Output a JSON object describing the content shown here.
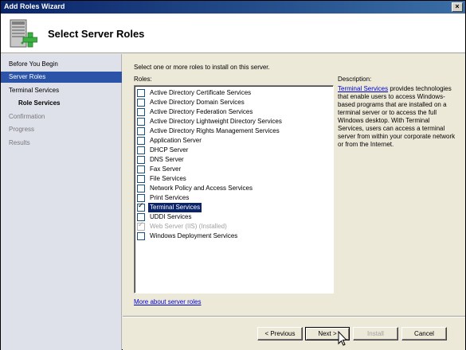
{
  "window": {
    "title": "Add Roles Wizard",
    "close_label": "×"
  },
  "header": {
    "title": "Select Server Roles",
    "icon": "server-roles-icon"
  },
  "nav": {
    "items": [
      {
        "label": "Before You Begin",
        "state": "normal"
      },
      {
        "label": "Server Roles",
        "state": "active"
      },
      {
        "label": "Terminal Services",
        "state": "normal"
      },
      {
        "label": "Role Services",
        "state": "sub"
      },
      {
        "label": "Confirmation",
        "state": "disabled"
      },
      {
        "label": "Progress",
        "state": "disabled"
      },
      {
        "label": "Results",
        "state": "disabled"
      }
    ]
  },
  "main": {
    "instruction": "Select one or more roles to install on this server.",
    "roles_label": "Roles:",
    "roles": [
      {
        "label": "Active Directory Certificate Services",
        "checked": false,
        "enabled": true
      },
      {
        "label": "Active Directory Domain Services",
        "checked": false,
        "enabled": true
      },
      {
        "label": "Active Directory Federation Services",
        "checked": false,
        "enabled": true
      },
      {
        "label": "Active Directory Lightweight Directory Services",
        "checked": false,
        "enabled": true
      },
      {
        "label": "Active Directory Rights Management Services",
        "checked": false,
        "enabled": true
      },
      {
        "label": "Application Server",
        "checked": false,
        "enabled": true
      },
      {
        "label": "DHCP Server",
        "checked": false,
        "enabled": true
      },
      {
        "label": "DNS Server",
        "checked": false,
        "enabled": true
      },
      {
        "label": "Fax Server",
        "checked": false,
        "enabled": true
      },
      {
        "label": "File Services",
        "checked": false,
        "enabled": true
      },
      {
        "label": "Network Policy and Access Services",
        "checked": false,
        "enabled": true
      },
      {
        "label": "Print Services",
        "checked": false,
        "enabled": true
      },
      {
        "label": "Terminal Services",
        "checked": true,
        "enabled": true,
        "selected": true
      },
      {
        "label": "UDDI Services",
        "checked": false,
        "enabled": true
      },
      {
        "label": "Web Server (IIS)  (Installed)",
        "checked": true,
        "enabled": false
      },
      {
        "label": "Windows Deployment Services",
        "checked": false,
        "enabled": true
      }
    ],
    "description_heading": "Description:",
    "description_link": "Terminal Services",
    "description_text": " provides technologies that enable users to access Windows-based programs that are installed on a terminal server or to access the full Windows desktop. With Terminal Services, users can access a terminal server from within your corporate network or from the Internet.",
    "more_link": "More about server roles"
  },
  "footer": {
    "previous": "< Previous",
    "next": "Next >",
    "install": "Install",
    "cancel": "Cancel"
  },
  "colors": {
    "title_bar": "#0a246a",
    "nav_active": "#2b54a8",
    "link": "#0000cc"
  }
}
